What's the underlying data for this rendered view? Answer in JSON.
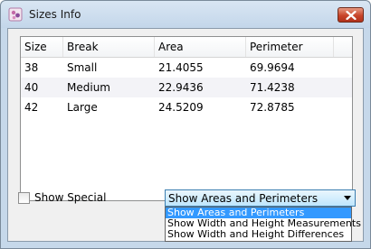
{
  "window": {
    "title": "Sizes Info",
    "close_label": "close"
  },
  "table": {
    "columns": [
      "Size",
      "Break",
      "Area",
      "Perimeter"
    ],
    "rows": [
      [
        "38",
        "Small",
        "21.4055",
        "69.9694"
      ],
      [
        "40",
        "Medium",
        "22.9436",
        "71.4238"
      ],
      [
        "42",
        "Large",
        "24.5209",
        "72.8785"
      ]
    ]
  },
  "show_special": {
    "label": "Show Special",
    "checked": false
  },
  "combo": {
    "selected": "Show Areas and Perimeters",
    "options": [
      "Show Areas and Perimeters",
      "Show Width and Height Measurements",
      "Show Width and Height Differences"
    ],
    "highlighted_index": 0
  },
  "colors": {
    "highlight": "#3399ff",
    "close_button": "#c8452a"
  },
  "icons": {
    "app": "puzzle-app-icon",
    "close": "close-icon",
    "dropdown": "chevron-down-icon"
  }
}
